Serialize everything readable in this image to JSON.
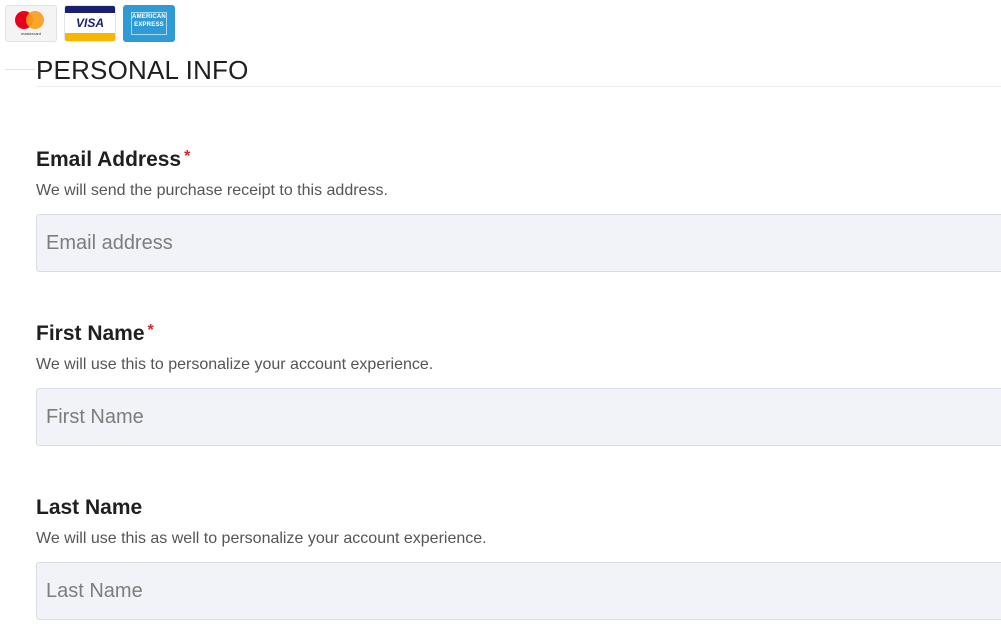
{
  "payment_methods": [
    {
      "name": "mastercard-icon",
      "caption": "mastercard"
    },
    {
      "name": "visa-icon",
      "caption": "VISA"
    },
    {
      "name": "american-express-icon",
      "caption": "AMERICAN EXPRESS"
    }
  ],
  "colors": {
    "required_marker": "#d4262c",
    "input_background": "#f1f3f8"
  },
  "section": {
    "title": "PERSONAL INFO"
  },
  "fields": [
    {
      "label": "Email Address",
      "required": "*",
      "description": "We will send the purchase receipt to this address.",
      "placeholder": "Email address",
      "value": ""
    },
    {
      "label": "First Name",
      "required": "*",
      "description": "We will use this to personalize your account experience.",
      "placeholder": "First Name",
      "value": ""
    },
    {
      "label": "Last Name",
      "required": "",
      "description": "We will use this as well to personalize your account experience.",
      "placeholder": "Last Name",
      "value": ""
    }
  ]
}
